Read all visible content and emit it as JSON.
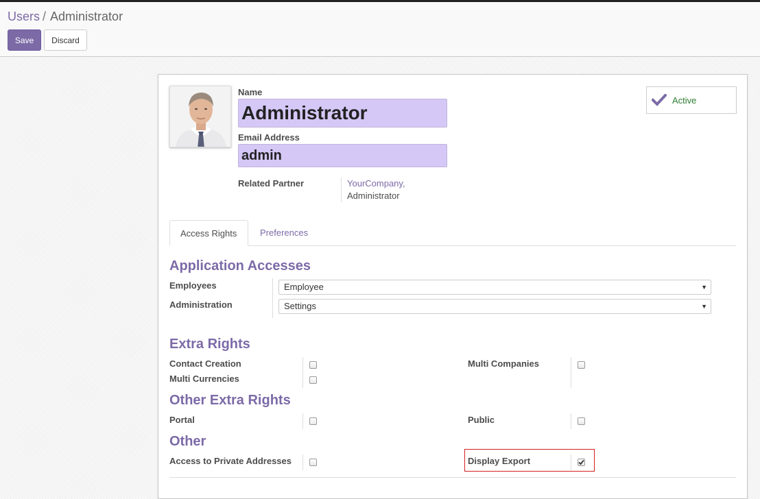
{
  "breadcrumb": {
    "parent": "Users",
    "separator": "/",
    "current": "Administrator"
  },
  "toolbar": {
    "save_label": "Save",
    "discard_label": "Discard"
  },
  "colors": {
    "accent": "#7c6aa7",
    "input_bg": "#d5c8f7",
    "active_text": "#2e7d32",
    "highlight_border": "#d61f1f"
  },
  "form": {
    "name_label": "Name",
    "name_value": "Administrator",
    "email_label": "Email Address",
    "email_value": "admin",
    "partner_label": "Related Partner",
    "partner_company": "YourCompany,",
    "partner_name": "Administrator",
    "active_label": "Active"
  },
  "tabs": [
    {
      "label": "Access Rights",
      "active": true
    },
    {
      "label": "Preferences",
      "active": false
    }
  ],
  "sections": {
    "app_accesses": "Application Accesses",
    "extra_rights": "Extra Rights",
    "other_extra_rights": "Other Extra Rights",
    "other": "Other"
  },
  "app_fields": [
    {
      "label": "Employees",
      "value": "Employee"
    },
    {
      "label": "Administration",
      "value": "Settings"
    }
  ],
  "rights": {
    "contact_creation": {
      "label": "Contact Creation",
      "checked": false
    },
    "multi_companies": {
      "label": "Multi Companies",
      "checked": false
    },
    "multi_currencies": {
      "label": "Multi Currencies",
      "checked": false
    },
    "portal": {
      "label": "Portal",
      "checked": false
    },
    "public": {
      "label": "Public",
      "checked": false
    },
    "private_addresses": {
      "label": "Access to Private Addresses",
      "checked": false
    },
    "display_export": {
      "label": "Display Export",
      "checked": true
    }
  }
}
